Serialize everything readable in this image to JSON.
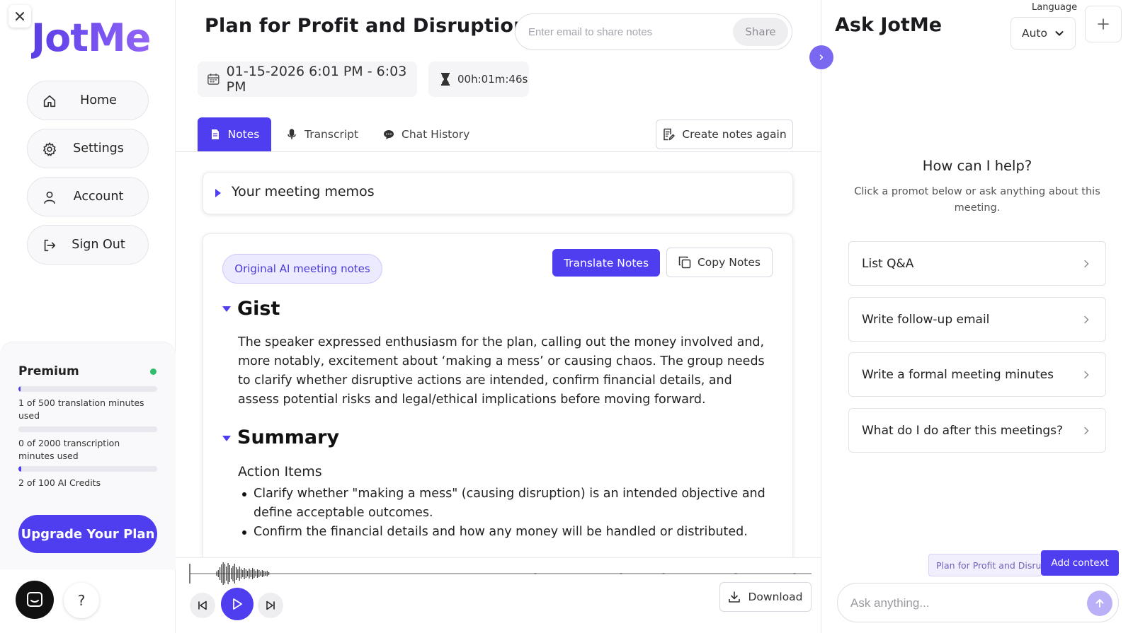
{
  "sidebar": {
    "logo": "JotMe",
    "nav": [
      {
        "label": "Home",
        "icon": "home-icon"
      },
      {
        "label": "Settings",
        "icon": "gear-icon"
      },
      {
        "label": "Account",
        "icon": "user-icon"
      },
      {
        "label": "Sign Out",
        "icon": "sign-out-icon"
      }
    ],
    "plan": {
      "name": "Premium",
      "status_color": "#2ebd6b",
      "usage": [
        {
          "text": "1 of 500 translation minutes used",
          "fraction": 0.002
        },
        {
          "text": "0 of 2000 transcription minutes used",
          "fraction": 0.0
        },
        {
          "text": "2 of 100 AI Credits",
          "fraction": 0.02
        }
      ],
      "upgrade_label": "Upgrade Your Plan"
    },
    "help_label": "?"
  },
  "main": {
    "title": "Plan for Profit and Disruption",
    "share": {
      "placeholder": "Enter email to share notes",
      "button": "Share"
    },
    "date_range": "01-15-2026 6:01 PM - 6:03 PM",
    "duration": "00h:01m:46s",
    "tabs": [
      {
        "label": "Notes",
        "active": true,
        "icon": "notes-icon"
      },
      {
        "label": "Transcript",
        "active": false,
        "icon": "microphone-icon"
      },
      {
        "label": "Chat History",
        "active": false,
        "icon": "chat-icon"
      }
    ],
    "create_again": "Create notes again",
    "memos_label": "Your meeting memos",
    "notes": {
      "badge": "Original AI meeting notes",
      "translate": "Translate Notes",
      "copy": "Copy Notes",
      "gist_title": "Gist",
      "gist_text": "The speaker expressed enthusiasm for the plan, calling out the money involved and, more notably, excitement about ‘making a mess’ or causing chaos. The group needs to clarify whether disruptive actions are intended, confirm financial details, and assess potential risks and legal/ethical implications before moving forward.",
      "summary_title": "Summary",
      "action_items_title": "Action Items",
      "action_items": [
        "Clarify whether \"making a mess\" (causing disruption) is an intended objective and define acceptable outcomes.",
        "Confirm the financial details and how any money will be handled or distributed."
      ]
    },
    "player": {
      "download": "Download",
      "accent": "#4f3df0"
    }
  },
  "assistant": {
    "title": "Ask JotMe",
    "language_label": "Language",
    "language_value": "Auto",
    "help_title": "How can I help?",
    "help_subtitle": "Click a promot below or ask anything about this meeting.",
    "prompts": [
      "List Q&A",
      "Write follow-up email",
      "Write a formal meeting minutes",
      "What do I do after this meetings?"
    ],
    "context_chip": "Plan for Profit and Disru",
    "add_context": "Add context",
    "input_placeholder": "Ask anything..."
  }
}
